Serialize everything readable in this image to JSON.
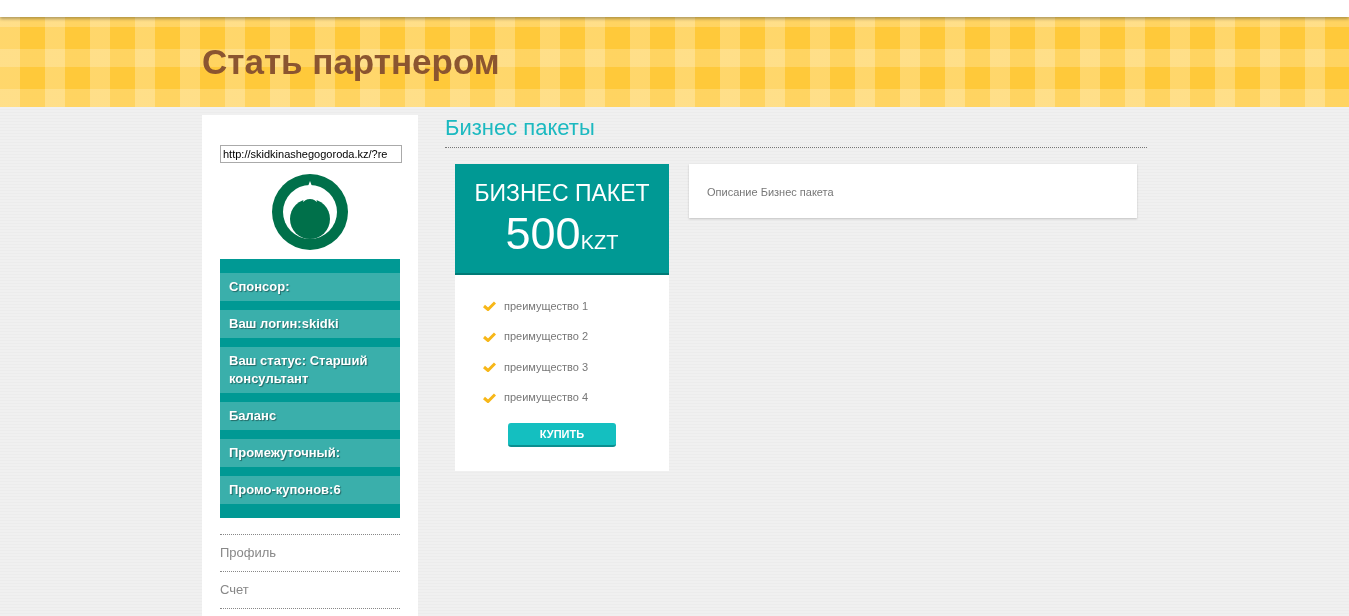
{
  "page_title": "Стать партнером",
  "sidebar": {
    "referral_link": "http://skidkinashegogoroda.kz/?re",
    "info_items": [
      {
        "label": "Спонсор:"
      },
      {
        "label": "Ваш логин:skidki"
      },
      {
        "label": "Ваш статус: Старший консультант"
      },
      {
        "label": "Баланс"
      },
      {
        "label": "Промежуточный:"
      },
      {
        "label": "Промо-купонов:6"
      }
    ],
    "menu": [
      {
        "label": "Профиль"
      },
      {
        "label": "Счет"
      }
    ]
  },
  "section_title": "Бизнес пакеты",
  "package": {
    "name": "БИЗНЕС ПАКЕТ",
    "price": "500",
    "currency": "KZT",
    "features": [
      "преимущество 1",
      "преимущество 2",
      "преимущество 3",
      "преимущество 4"
    ],
    "button": "КУПИТЬ"
  },
  "description": "Описание Бизнес пакета"
}
